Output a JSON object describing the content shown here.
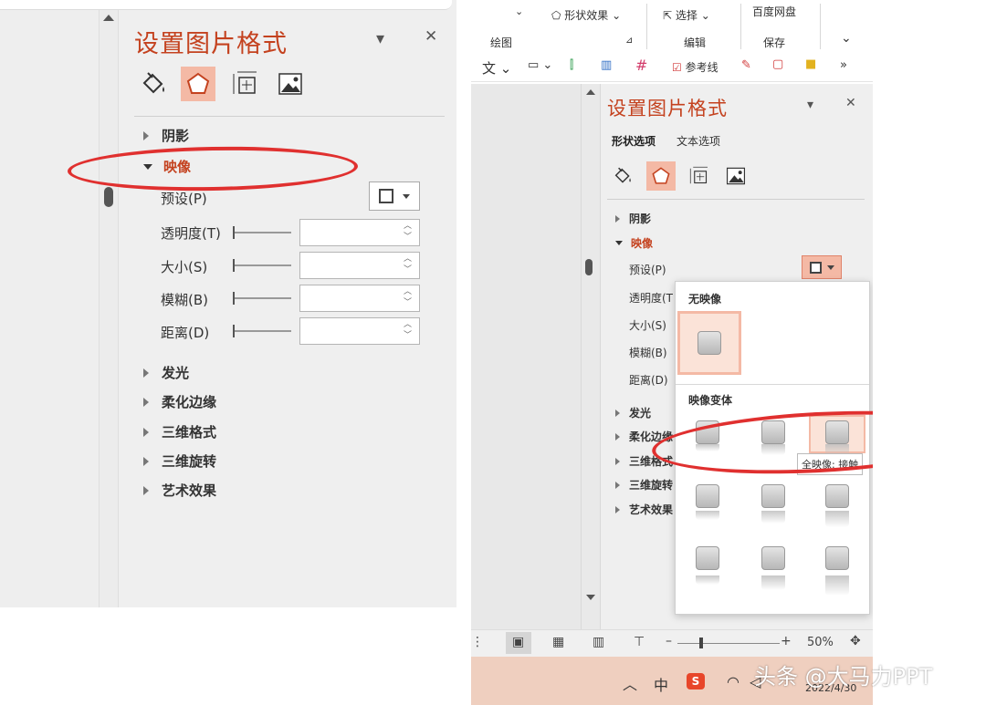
{
  "left_panel": {
    "title": "设置图片格式",
    "controls": {
      "collapse": "▾",
      "close": "✕"
    },
    "tabs": [
      {
        "name": "fill-line-icon",
        "selected": false
      },
      {
        "name": "effects-icon",
        "selected": true
      },
      {
        "name": "size-properties-icon",
        "selected": false
      },
      {
        "name": "picture-icon",
        "selected": false
      }
    ],
    "sections_before": [
      {
        "label": "阴影",
        "expanded": false
      },
      {
        "label": "映像",
        "expanded": true
      }
    ],
    "fields": [
      {
        "label": "预设(P)"
      },
      {
        "label": "透明度(T)"
      },
      {
        "label": "大小(S)"
      },
      {
        "label": "模糊(B)"
      },
      {
        "label": "距离(D)"
      }
    ],
    "sections_after": [
      {
        "label": "发光"
      },
      {
        "label": "柔化边缘"
      },
      {
        "label": "三维格式"
      },
      {
        "label": "三维旋转"
      },
      {
        "label": "艺术效果"
      }
    ]
  },
  "right_panel": {
    "ribbon": {
      "shape_effects": "形状效果",
      "select": "选择",
      "baidu": "百度网盘",
      "group_drawing": "绘图",
      "group_edit": "编辑",
      "group_save": "保存"
    },
    "quickbar": {
      "text": "文",
      "guides": "参考线",
      "more": "»"
    },
    "title": "设置图片格式",
    "controls": {
      "collapse": "▾",
      "close": "✕"
    },
    "option_tabs": [
      "形状选项",
      "文本选项"
    ],
    "sections_before": [
      {
        "label": "阴影",
        "expanded": false
      },
      {
        "label": "映像",
        "expanded": true
      }
    ],
    "fields": [
      "预设(P)",
      "透明度(T",
      "大小(S)",
      "模糊(B)",
      "距离(D)"
    ],
    "sections_after": [
      "发光",
      "柔化边缘",
      "三维格式",
      "三维旋转",
      "艺术效果"
    ],
    "popup": {
      "header_none": "无映像",
      "header_variants": "映像变体",
      "tooltip": "全映像: 接触"
    },
    "statusbar": {
      "zoom": "50%",
      "minus": "–",
      "plus": "+"
    },
    "taskbar": {
      "date": "2022/4/30"
    },
    "watermark": "头条 @大马力PPT"
  },
  "colors": {
    "accent": "#c4421f",
    "selected_tab_bg": "#f4b9a5",
    "annotation_red": "#e0302f"
  }
}
